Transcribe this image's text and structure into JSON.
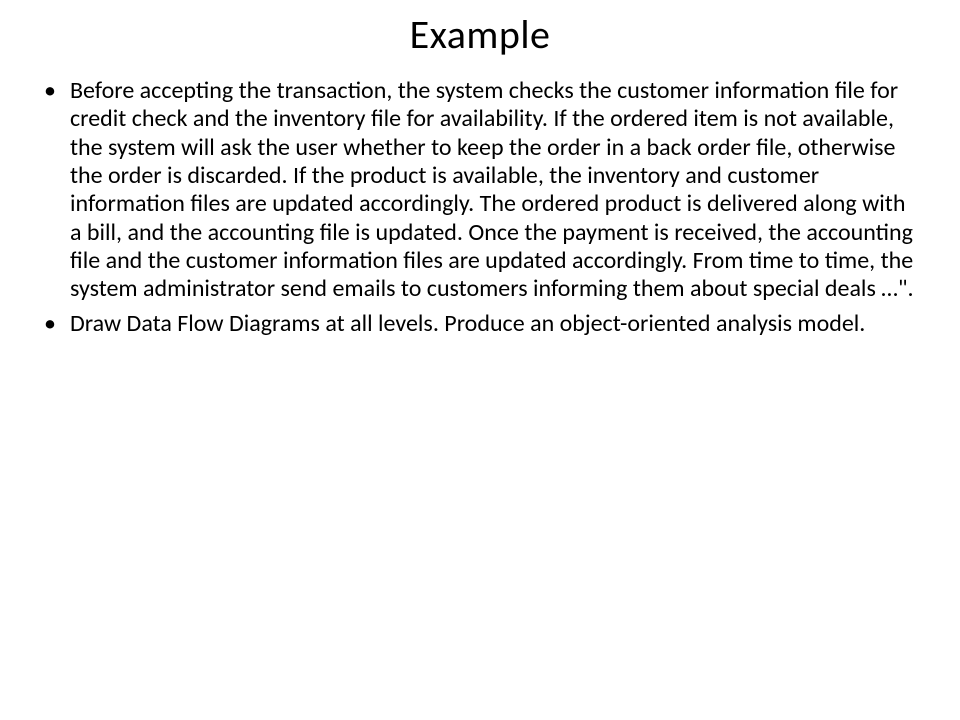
{
  "slide": {
    "title": "Example",
    "bullets": [
      "Before accepting the transaction, the system checks the customer information file for credit check and the inventory file for availability. If the ordered item is not available, the system will ask the user whether to keep the order in a back order file, otherwise the order is discarded. If the product is available, the inventory and customer information files are updated accordingly. The ordered product is delivered along with a bill, and the accounting file is updated. Once the payment is received, the accounting file and the customer information files are updated accordingly. From time to time, the system administrator send emails to customers informing them about special deals …\".",
      "Draw Data Flow Diagrams at all levels. Produce an object-oriented analysis model."
    ]
  }
}
